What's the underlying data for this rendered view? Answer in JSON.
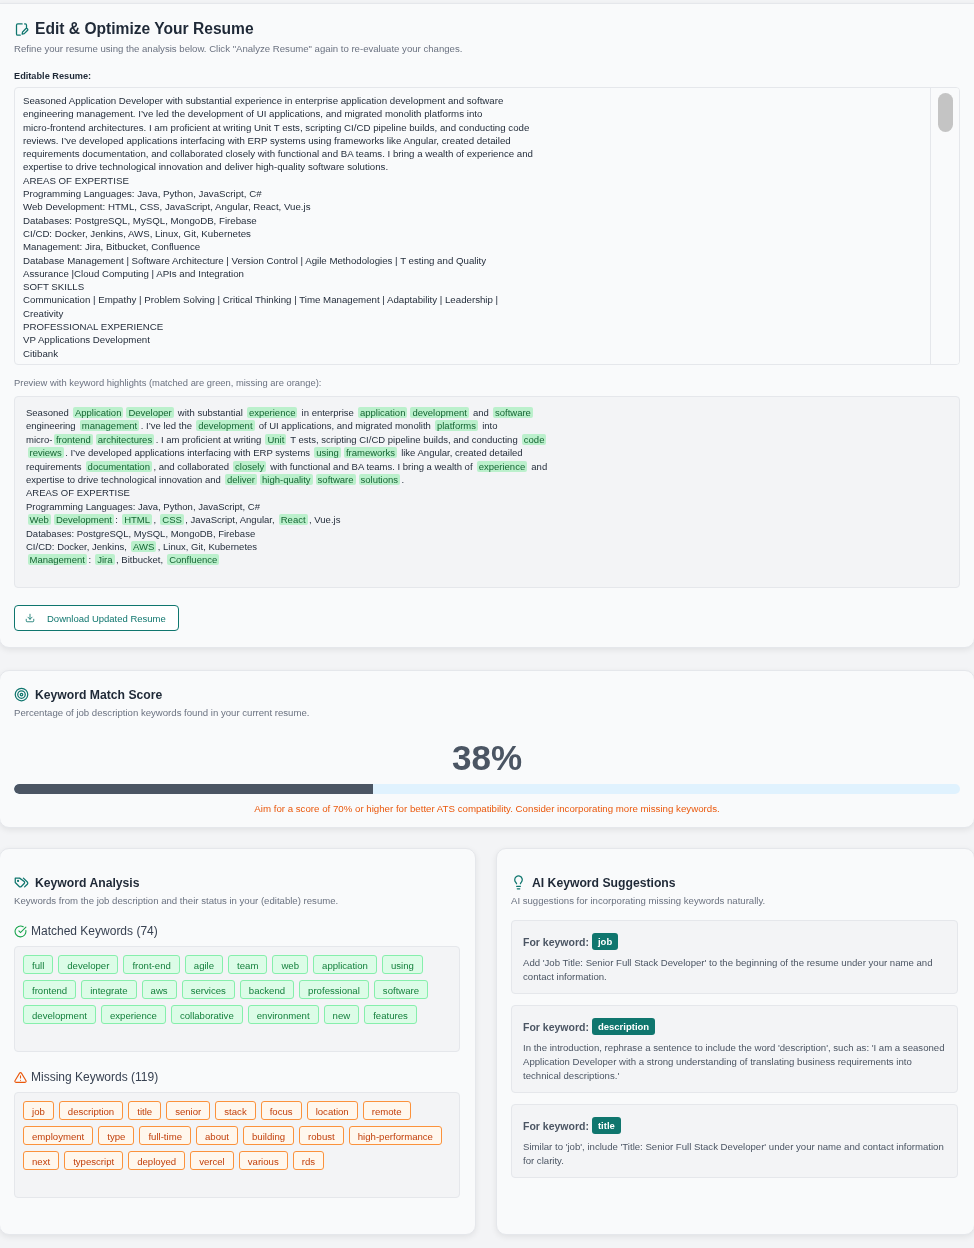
{
  "editor": {
    "title": "Edit & Optimize Your Resume",
    "subtitle": "Refine your resume using the analysis below. Click \"Analyze Resume\" again to re-evaluate your changes.",
    "resume_label": "Editable Resume:",
    "resume_lines": [
      "Seasoned Application Developer with substantial experience in enterprise application development and software",
      "engineering management. I’ve led the development of UI applications, and migrated monolith platforms into",
      "micro-frontend architectures. I am proficient at writing Unit T ests, scripting CI/CD pipeline builds, and conducting code",
      "reviews. I’ve developed applications interfacing with ERP systems using frameworks like Angular, created detailed",
      "requirements documentation, and collaborated closely with functional and BA teams. I bring a wealth of experience and",
      "expertise to drive technological innovation and deliver high-quality software solutions.",
      "AREAS OF EXPERTISE",
      "Programming Languages: Java, Python, JavaScript, C#",
      "Web Development: HTML, CSS, JavaScript, Angular, React, Vue.js",
      "Databases: PostgreSQL, MySQL, MongoDB, Firebase",
      "CI/CD: Docker, Jenkins, AWS, Linux, Git, Kubernetes",
      "Management: Jira, Bitbucket, Confluence",
      "Database Management | Software Architecture | Version Control | Agile Methodologies | T esting and Quality",
      "Assurance |Cloud Computing | APIs and Integration",
      "SOFT SKILLS",
      "Communication | Empathy | Problem Solving | Critical Thinking | Time Management | Adaptability | Leadership |",
      "Creativity",
      "PROFESSIONAL EXPERIENCE",
      "VP Applications Development",
      "Citibank"
    ],
    "preview_label": "Preview with keyword highlights (matched are green, missing are orange):",
    "preview_lines": [
      [
        "Seasoned ",
        {
          "kw": "Application",
          "kind": "matched"
        },
        {
          "kw": "Developer",
          "kind": "matched"
        },
        " with substantial ",
        {
          "kw": "experience",
          "kind": "matched"
        },
        " in enterprise ",
        {
          "kw": "application",
          "kind": "matched"
        },
        {
          "kw": "development",
          "kind": "matched"
        },
        " and ",
        {
          "kw": "software",
          "kind": "matched"
        }
      ],
      [
        "engineering ",
        {
          "kw": "management",
          "kind": "matched"
        },
        ". I’ve led the ",
        {
          "kw": "development",
          "kind": "matched"
        },
        " of UI applications, and migrated monolith ",
        {
          "kw": "platforms",
          "kind": "matched"
        },
        " into"
      ],
      [
        "micro-",
        {
          "kw": "frontend",
          "kind": "matched"
        },
        {
          "kw": "architectures",
          "kind": "matched"
        },
        ". I am proficient at writing ",
        {
          "kw": "Unit",
          "kind": "matched"
        },
        " T ests, scripting CI/CD pipeline builds, and conducting ",
        {
          "kw": "code",
          "kind": "matched"
        }
      ],
      [
        {
          "kw": "reviews",
          "kind": "matched"
        },
        ". I’ve developed applications interfacing with ERP systems ",
        {
          "kw": "using",
          "kind": "matched"
        },
        {
          "kw": "frameworks",
          "kind": "matched"
        },
        " like Angular, created detailed"
      ],
      [
        "requirements ",
        {
          "kw": "documentation",
          "kind": "matched"
        },
        ", and collaborated ",
        {
          "kw": "closely",
          "kind": "matched"
        },
        " with functional and BA teams. I bring a wealth of ",
        {
          "kw": "experience",
          "kind": "matched"
        },
        " and"
      ],
      [
        "expertise to drive technological innovation and ",
        {
          "kw": "deliver",
          "kind": "matched"
        },
        {
          "kw": "high-quality",
          "kind": "matched"
        },
        {
          "kw": "software",
          "kind": "matched"
        },
        {
          "kw": "solutions",
          "kind": "matched"
        },
        "."
      ],
      [
        "AREAS OF EXPERTISE"
      ],
      [
        "Programming Languages: Java, Python, JavaScript, C#"
      ],
      [
        {
          "kw": "Web",
          "kind": "matched"
        },
        {
          "kw": "Development",
          "kind": "matched"
        },
        ": ",
        {
          "kw": "HTML",
          "kind": "matched"
        },
        ", ",
        {
          "kw": "CSS",
          "kind": "matched"
        },
        ", JavaScript, Angular, ",
        {
          "kw": "React",
          "kind": "matched"
        },
        ", Vue.js"
      ],
      [
        "Databases: PostgreSQL, MySQL, MongoDB, Firebase"
      ],
      [
        "CI/CD: Docker, Jenkins, ",
        {
          "kw": "AWS",
          "kind": "matched"
        },
        ", Linux, Git, Kubernetes"
      ],
      [
        {
          "kw": "Management",
          "kind": "matched"
        },
        ": ",
        {
          "kw": "Jira",
          "kind": "matched"
        },
        ", Bitbucket, ",
        {
          "kw": "Confluence",
          "kind": "matched"
        }
      ]
    ],
    "download_button": "Download Updated Resume"
  },
  "score": {
    "title": "Keyword Match Score",
    "subtitle": "Percentage of job description keywords found in your current resume.",
    "value": "38%",
    "level": 0.38,
    "hint": "Aim for a score of 70% or higher for better ATS compatibility. Consider incorporating more missing keywords."
  },
  "analysis": {
    "title": "Keyword Analysis",
    "subtitle": "Keywords from the job description and their status in your (editable) resume.",
    "groups": [
      {
        "kind": "matched",
        "title": "Matched Keywords (74)",
        "keywords": [
          "full",
          "developer",
          "front-end",
          "agile",
          "team",
          "web",
          "application",
          "using",
          "frontend",
          "integrate",
          "aws",
          "services",
          "backend",
          "professional",
          "software",
          "development",
          "experience",
          "collaborative",
          "environment",
          "new",
          "features"
        ]
      },
      {
        "kind": "missing",
        "title": "Missing Keywords (119)",
        "keywords": [
          "job",
          "description",
          "title",
          "senior",
          "stack",
          "focus",
          "location",
          "remote",
          "employment",
          "type",
          "full-time",
          "about",
          "building",
          "robust",
          "high-performance",
          "next",
          "typescript",
          "deployed",
          "vercel",
          "various",
          "rds"
        ]
      }
    ]
  },
  "suggestions": {
    "title": "AI Keyword Suggestions",
    "subtitle": "AI suggestions for incorporating missing keywords naturally.",
    "items": [
      {
        "label": "For keyword:",
        "keyword": "job",
        "text": "Add 'Job Title: Senior Full Stack Developer' to the beginning of the resume under your name and contact information."
      },
      {
        "label": "For keyword:",
        "keyword": "description",
        "text": "In the introduction, rephrase a sentence to include the word 'description', such as: 'I am a seasoned Application Developer with a strong understanding of translating business requirements into technical descriptions.'"
      },
      {
        "label": "For keyword:",
        "keyword": "title",
        "text": "Similar to 'job', include 'Title: Senior Full Stack Developer' under your name and contact information for clarity."
      }
    ]
  }
}
